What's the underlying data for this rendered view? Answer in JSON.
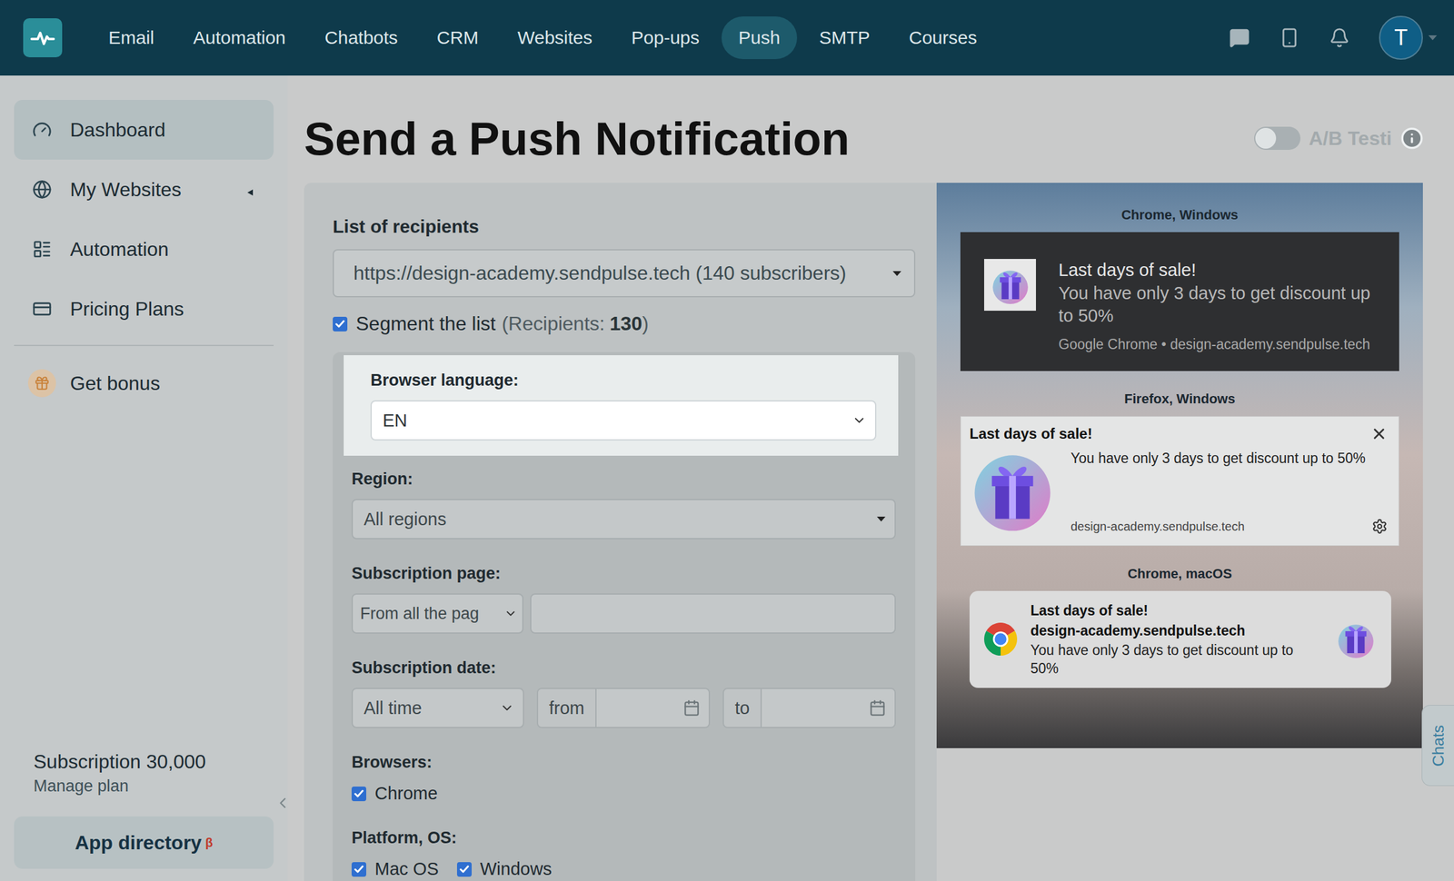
{
  "nav": {
    "items": [
      {
        "label": "Email",
        "selected": false
      },
      {
        "label": "Automation",
        "selected": false
      },
      {
        "label": "Chatbots",
        "selected": false
      },
      {
        "label": "CRM",
        "selected": false
      },
      {
        "label": "Websites",
        "selected": false
      },
      {
        "label": "Pop-ups",
        "selected": false
      },
      {
        "label": "Push",
        "selected": true
      },
      {
        "label": "SMTP",
        "selected": false
      },
      {
        "label": "Courses",
        "selected": false
      }
    ],
    "avatar": "T"
  },
  "sidebar": {
    "items": [
      {
        "label": "Dashboard",
        "selected": true,
        "kind": "link"
      },
      {
        "label": "My Websites",
        "selected": false,
        "kind": "group",
        "expanded": false
      },
      {
        "label": "Automation",
        "selected": false,
        "kind": "link"
      },
      {
        "label": "Pricing Plans",
        "selected": false,
        "kind": "link"
      }
    ],
    "bonus": "Get bonus",
    "subscription": "Subscription 30,000",
    "manage": "Manage plan",
    "app_directory": {
      "label": "App directory",
      "badge": "β"
    }
  },
  "page": {
    "title": "Send a Push Notification",
    "ab_testing": {
      "label": "A/B Testi",
      "on": false
    }
  },
  "form": {
    "recipients": {
      "label": "List of recipients",
      "value": "https://design-academy.sendpulse.tech (140 subscribers)"
    },
    "segment": {
      "label": "Segment the list",
      "checked": true,
      "count_label": "(Recipients:",
      "count": "130",
      "count_end": ")"
    },
    "filters": [
      {
        "kind": "select",
        "label": "Browser language:",
        "value": "EN",
        "highlighted": true
      },
      {
        "kind": "dropdown",
        "label": "Region:",
        "value": "All regions",
        "highlighted": false
      },
      {
        "kind": "page",
        "label": "Subscription page:",
        "value": "From all the pag",
        "input": "",
        "highlighted": false
      },
      {
        "kind": "date",
        "label": "Subscription date:",
        "value": "All time",
        "from": "from",
        "to": "to",
        "highlighted": false
      },
      {
        "kind": "checks",
        "label": "Browsers:",
        "options": [
          {
            "label": "Chrome",
            "checked": true
          }
        ],
        "highlighted": false
      },
      {
        "kind": "checks",
        "label": "Platform, OS:",
        "options": [
          {
            "label": "Mac OS",
            "checked": true
          },
          {
            "label": "Windows",
            "checked": true
          }
        ],
        "highlighted": false
      }
    ]
  },
  "preview": {
    "notifications": [
      {
        "kind": "chrome-windows",
        "label": "Chrome, Windows",
        "title": "Last days of sale!",
        "body": "You have only 3 days to get discount up to 50%",
        "source": "Google Chrome • design-academy.sendpulse.tech"
      },
      {
        "kind": "firefox-windows",
        "label": "Firefox, Windows",
        "title": "Last days of sale!",
        "body": "You have only 3 days to get discount up to 50%",
        "source": "design-academy.sendpulse.tech"
      },
      {
        "kind": "chrome-macos",
        "label": "Chrome, macOS",
        "title": "Last days of sale!",
        "body": "You have only 3 days to get discount up to 50%",
        "source": "design-academy.sendpulse.tech"
      }
    ]
  },
  "chats_tab": "Chats"
}
